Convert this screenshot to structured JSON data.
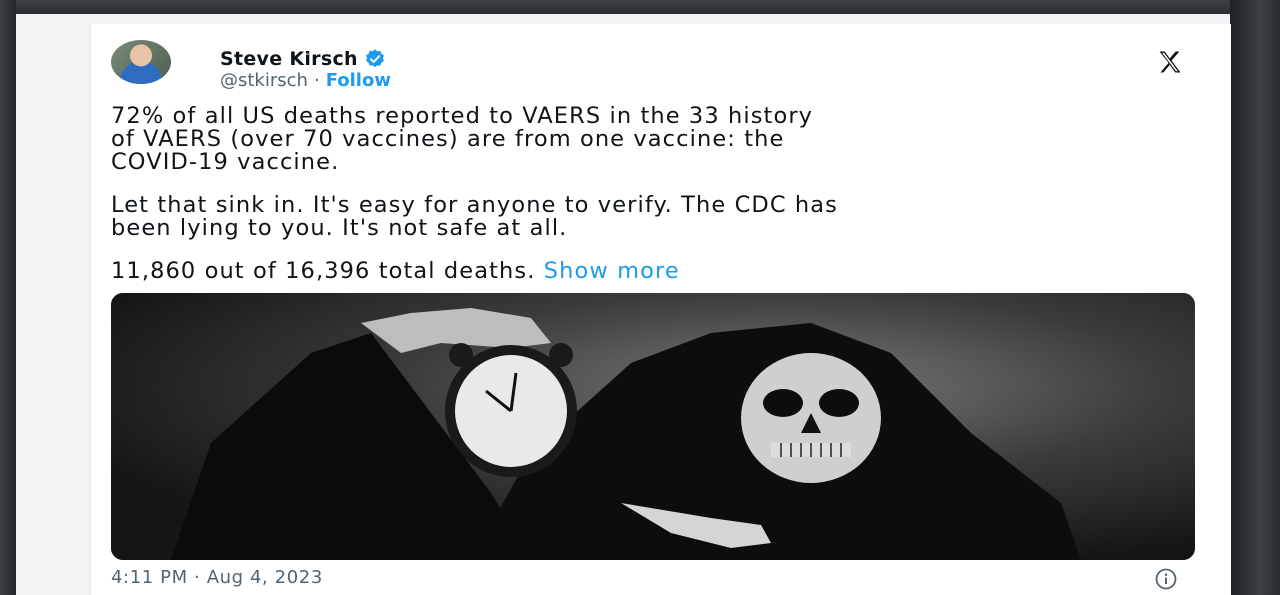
{
  "tweet": {
    "author": {
      "name": "Steve Kirsch",
      "handle": "@stkirsch",
      "separator": "·",
      "follow_label": "Follow"
    },
    "text": {
      "paragraph1_line1": "72% of all US deaths reported to VAERS in the 33 history",
      "paragraph1_line2": "of VAERS (over 70 vaccines) are from one vaccine: the",
      "paragraph1_line3": "COVID-19 vaccine.",
      "paragraph2_line1": "Let that sink in. It's easy for anyone to verify. The CDC has",
      "paragraph2_line2": "been lying to you. It's not safe at all.",
      "paragraph3": "11,860 out of 16,396 total deaths.",
      "show_more_label": "Show more"
    },
    "timestamp": "4:11 PM · Aug 4, 2023",
    "icons": {
      "verified": "verified-badge-icon",
      "platform": "x-logo-icon",
      "info": "info-icon"
    },
    "colors": {
      "accent": "#1d9bf0",
      "text": "#0f1419",
      "muted": "#536471"
    }
  }
}
